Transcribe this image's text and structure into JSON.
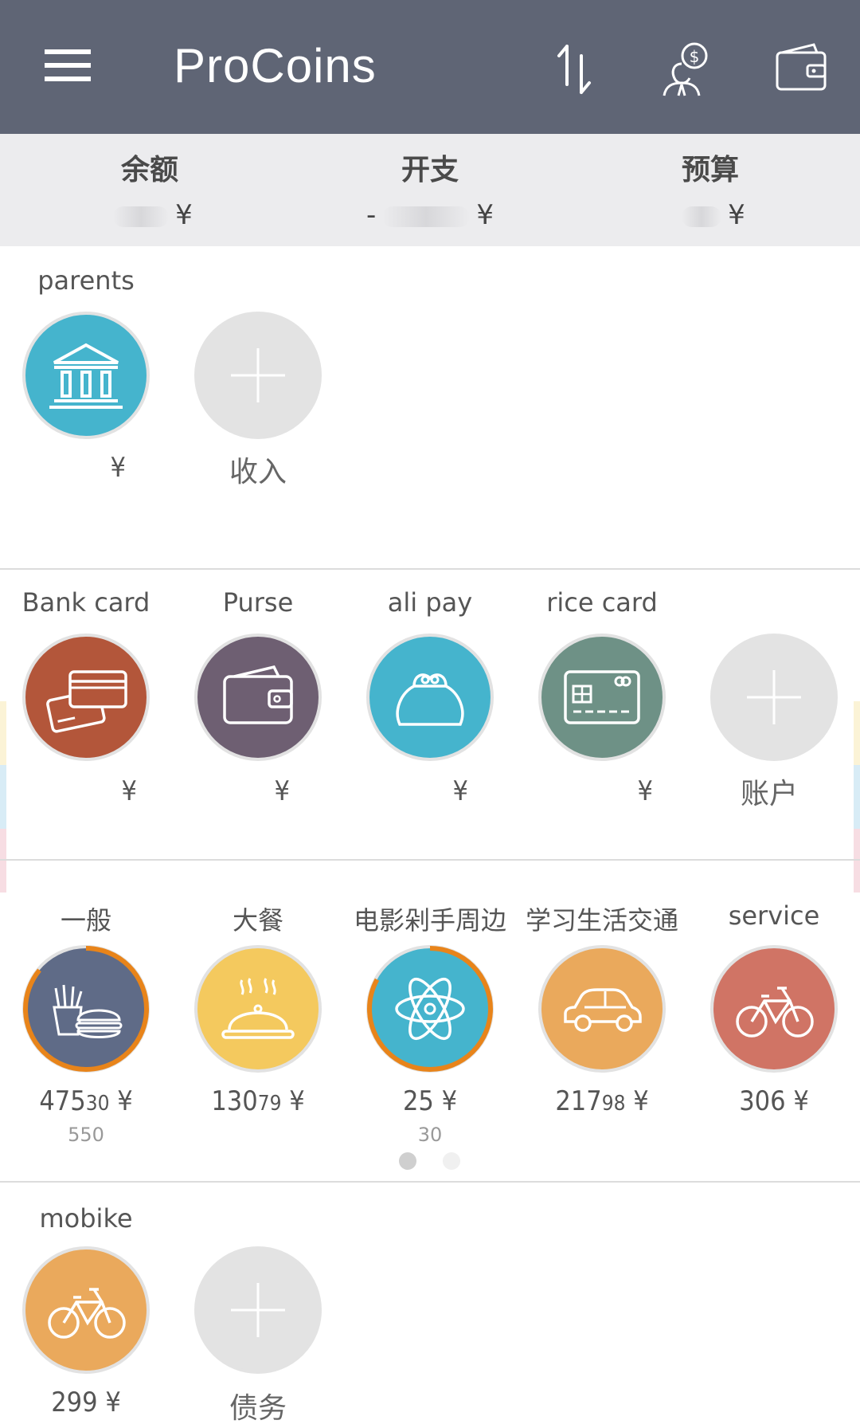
{
  "header": {
    "title": "ProCoins",
    "icons": [
      "menu-icon",
      "transfer-icon",
      "money-person-icon",
      "wallet-icon"
    ]
  },
  "summary": {
    "balance_label": "余额",
    "balance_currency": "¥",
    "expense_label": "开支",
    "expense_sign": "-",
    "expense_currency": "¥",
    "budget_label": "预算",
    "budget_currency": "¥"
  },
  "income": {
    "items": [
      {
        "label": "parents",
        "currency": "¥",
        "icon": "bank-icon",
        "color": "#45b4cd"
      }
    ],
    "add_label": "收入"
  },
  "accounts": {
    "items": [
      {
        "label": "Bank card",
        "currency": "¥",
        "icon": "credit-cards-icon",
        "color": "#b3563a"
      },
      {
        "label": "Purse",
        "currency": "¥",
        "icon": "wallet-icon",
        "color": "#6e5f72"
      },
      {
        "label": "ali pay",
        "currency": "¥",
        "icon": "coin-purse-icon",
        "color": "#45b4cd"
      },
      {
        "label": "rice card",
        "currency": "¥",
        "icon": "card-chip-icon",
        "color": "#6e9186"
      }
    ],
    "add_label": "账户"
  },
  "expenses": {
    "items": [
      {
        "label": "一般",
        "amount_main": "475",
        "amount_decimal": "30",
        "currency": "¥",
        "budget": "550",
        "icon": "fast-food-icon",
        "color": "#5f6b87",
        "progress": 0.86
      },
      {
        "label": "大餐",
        "amount_main": "130",
        "amount_decimal": "79",
        "currency": "¥",
        "icon": "cloche-icon",
        "color": "#f4c95e"
      },
      {
        "label": "电影剁手周边",
        "amount_main": "25",
        "amount_decimal": "",
        "currency": "¥",
        "budget": "30",
        "icon": "atom-icon",
        "color": "#45b4cd",
        "progress": 0.83
      },
      {
        "label": "学习生活交通",
        "amount_main": "217",
        "amount_decimal": "98",
        "currency": "¥",
        "icon": "car-icon",
        "color": "#eaa95c"
      },
      {
        "label": "service",
        "amount_main": "306",
        "amount_decimal": "",
        "currency": "¥",
        "icon": "bicycle-icon",
        "color": "#d07465"
      }
    ],
    "page_count": 2,
    "active_page": 1,
    "accent_color": "#e8841a"
  },
  "debts": {
    "items": [
      {
        "label": "mobike",
        "amount_main": "299",
        "currency": "¥",
        "icon": "bicycle-icon",
        "color": "#eaa95c"
      }
    ],
    "add_label": "债务"
  }
}
